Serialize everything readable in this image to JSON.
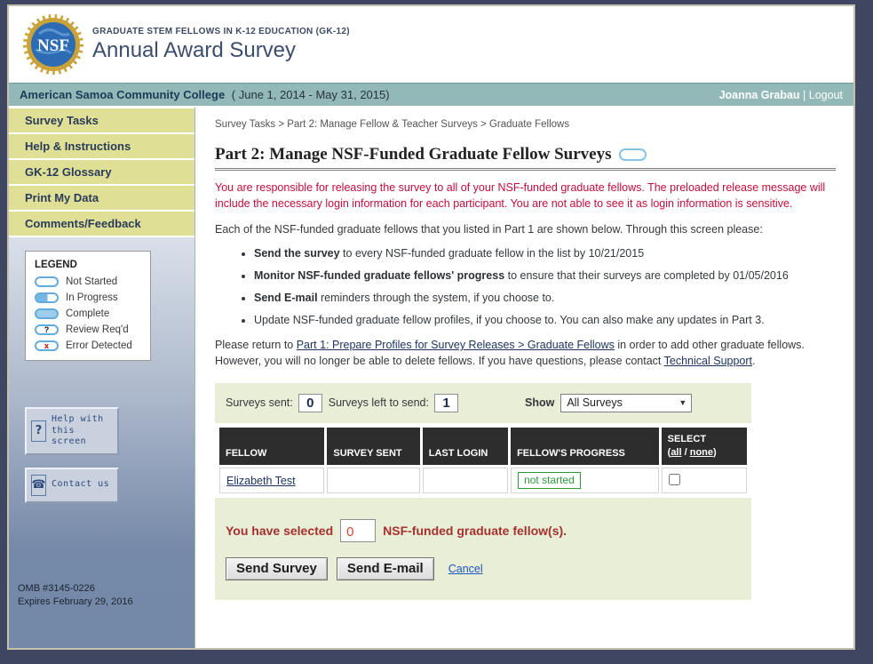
{
  "header": {
    "logo_text": "NSF",
    "program": "GRADUATE STEM FELLOWS IN K-12 EDUCATION (GK-12)",
    "title": "Annual Award Survey"
  },
  "org_bar": {
    "name": "American Samoa Community College",
    "period": "( June 1, 2014 - May 31, 2015)",
    "user": "Joanna Grabau",
    "separator": " | ",
    "logout": "Logout"
  },
  "sidebar": {
    "items": [
      {
        "label": "Survey Tasks"
      },
      {
        "label": "Help & Instructions"
      },
      {
        "label": "GK-12 Glossary"
      },
      {
        "label": "Print My Data"
      },
      {
        "label": "Comments/Feedback"
      }
    ],
    "legend": {
      "title": "LEGEND",
      "items": [
        {
          "label": "Not Started"
        },
        {
          "label": "In Progress"
        },
        {
          "label": "Complete"
        },
        {
          "label": "Review Req'd",
          "glyph": "?"
        },
        {
          "label": "Error Detected",
          "glyph": "x"
        }
      ]
    },
    "help_button": "Help with this screen",
    "help_icon": "?",
    "contact_button": "Contact us",
    "contact_icon": "☎",
    "omb_line1": "OMB #3145-0226",
    "omb_line2": "Expires February 29, 2016"
  },
  "main": {
    "breadcrumb": "Survey Tasks > Part 2: Manage Fellow & Teacher Surveys > Graduate Fellows",
    "title": "Part 2: Manage NSF-Funded Graduate Fellow Surveys",
    "intro_warning": "You are responsible for releasing the survey to all of your NSF-funded graduate fellows. The preloaded release message will include the necessary login information for each participant. You are not able to see it as login information is sensitive.",
    "intro": "Each of the NSF-funded graduate fellows that you listed in Part 1 are shown below. Through this screen please:",
    "bullets": [
      {
        "bold": "Send the survey",
        "rest": " to every NSF-funded graduate fellow in the list by 10/21/2015"
      },
      {
        "bold": "Monitor NSF-funded graduate fellows' progress",
        "rest": " to ensure that their surveys are completed by 01/05/2016"
      },
      {
        "bold": "Send E-mail",
        "rest": " reminders through the system, if you choose to."
      },
      {
        "bold": "",
        "rest": "Update NSF-funded graduate fellow profiles, if you choose to. You can also make any updates in Part 3."
      }
    ],
    "return_para": {
      "before": "Please return to ",
      "link1": "Part 1: Prepare Profiles for Survey Releases > Graduate Fellows",
      "middle": " in order to add other graduate fellows. However, you will no longer be able to delete fellows. If you have questions, please contact ",
      "link2": "Technical Support",
      "after": "."
    },
    "panel": {
      "surveys_sent_label": "Surveys sent:",
      "surveys_sent_value": "0",
      "surveys_left_label": "Surveys left to send:",
      "surveys_left_value": "1",
      "show_label": "Show",
      "show_value": "All Surveys",
      "table": {
        "headers": [
          "FELLOW",
          "SURVEY SENT",
          "LAST LOGIN",
          "FELLOW'S PROGRESS"
        ],
        "select_header": {
          "line1": "SELECT",
          "open": "(",
          "all": "all",
          "sep": " / ",
          "none": "none",
          "close": ")"
        },
        "rows": [
          {
            "fellow": "Elizabeth Test",
            "survey_sent": "",
            "last_login": "",
            "progress": "not started"
          }
        ]
      },
      "selected": {
        "before": "You have selected",
        "value": "0",
        "after": "NSF-funded graduate fellow(s)."
      },
      "send_survey_button": "Send Survey",
      "send_email_button": "Send E-mail",
      "cancel_link": "Cancel"
    }
  },
  "colors": {
    "outer_background": "#3e4662",
    "org_bar_teal": "#92b9b7",
    "menu_yellow": "#dfe096",
    "panel_green": "#e9efd6",
    "warning_red": "#c30d3c",
    "selected_red": "#a53030",
    "status_green": "#2e9b3e",
    "pill_blue": "#64abdd",
    "header_dark": "#2d2d2d"
  }
}
